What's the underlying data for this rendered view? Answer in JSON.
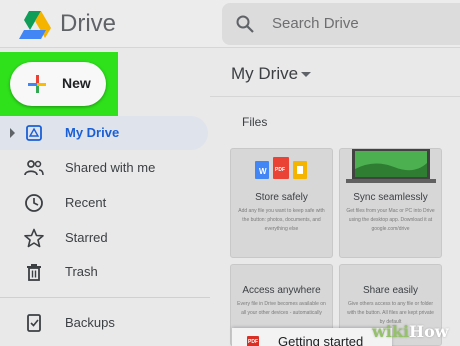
{
  "header": {
    "app_title": "Drive",
    "search_placeholder": "Search Drive"
  },
  "sidebar": {
    "new_button_label": "New",
    "items": [
      {
        "label": "My Drive",
        "icon": "drive-icon",
        "active": true
      },
      {
        "label": "Shared with me",
        "icon": "people-icon"
      },
      {
        "label": "Recent",
        "icon": "clock-icon"
      },
      {
        "label": "Starred",
        "icon": "star-icon"
      },
      {
        "label": "Trash",
        "icon": "trash-icon"
      },
      {
        "label": "Backups",
        "icon": "backup-icon"
      }
    ]
  },
  "main": {
    "title": "My Drive",
    "section_label": "Files",
    "cards": [
      {
        "title": "Store safely",
        "desc": "Add any file you want to keep safe with the button: photos, documents, and everything else"
      },
      {
        "title": "Sync seamlessly",
        "desc": "Get files from your Mac or PC into Drive using the desktop app. Download it at google.com/drive"
      },
      {
        "title": "Access anywhere",
        "desc": "Every file in Drive becomes available on all your other devices - automatically"
      },
      {
        "title": "Share easily",
        "desc": "Give others access to any file or folder with the button. All files are kept private by default"
      }
    ],
    "getting_started": {
      "icon_text": "PDF",
      "label": "Getting started"
    }
  },
  "watermark": {
    "wiki": "wiki",
    "how": "How"
  },
  "colors": {
    "highlight": "#2ee11b",
    "active_nav": "#1a5fd6",
    "background": "#e9e9ea"
  }
}
